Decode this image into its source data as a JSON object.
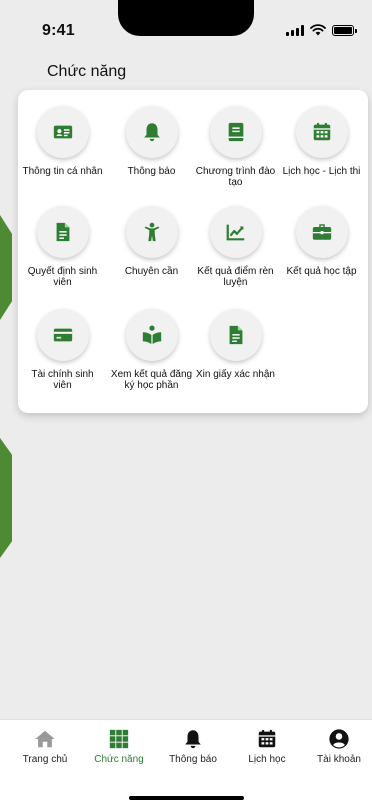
{
  "status": {
    "time": "9:41"
  },
  "page": {
    "title": "Chức năng"
  },
  "colors": {
    "accent": "#2e7d32",
    "icon_bg": "#f1f1f1",
    "deco": "#4e8a34",
    "inactive_tab": "#999999",
    "active_tab_icon": "#2e7d32"
  },
  "features": [
    {
      "label": "Thông tin cá nhân",
      "icon": "id-card-icon"
    },
    {
      "label": "Thông báo",
      "icon": "bell-icon"
    },
    {
      "label": "Chương trình đào tạo",
      "icon": "book-icon"
    },
    {
      "label": "Lịch học - Lịch thi",
      "icon": "calendar-icon"
    },
    {
      "label": "Quyết định sinh viên",
      "icon": "document-icon"
    },
    {
      "label": "Chuyên cần",
      "icon": "person-icon"
    },
    {
      "label": "Kết quả điểm rèn luyện",
      "icon": "chart-line-icon"
    },
    {
      "label": "Kết quả học tập",
      "icon": "briefcase-icon"
    },
    {
      "label": "Tài chính sinh viên",
      "icon": "credit-card-icon"
    },
    {
      "label": "Xem kết quả đăng ký học phần",
      "icon": "reading-icon"
    },
    {
      "label": "Xin giấy xác nhận",
      "icon": "file-icon"
    }
  ],
  "tabs": [
    {
      "label": "Trang chủ",
      "icon": "home-icon",
      "active": false
    },
    {
      "label": "Chức năng",
      "icon": "grid-icon",
      "active": true
    },
    {
      "label": "Thông báo",
      "icon": "bell-icon",
      "active": false
    },
    {
      "label": "Lịch học",
      "icon": "calendar-icon",
      "active": false
    },
    {
      "label": "Tài khoản",
      "icon": "account-icon",
      "active": false
    }
  ]
}
